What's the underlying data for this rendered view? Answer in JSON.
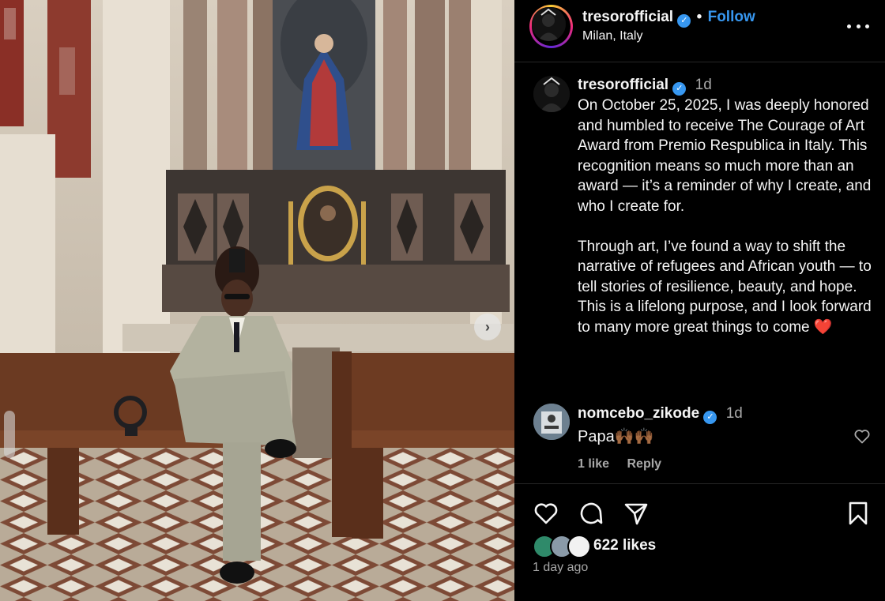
{
  "post": {
    "author": "tresorofficial",
    "location": "Milan, Italy",
    "follow_label": "Follow",
    "dot": "•",
    "verified_mark": "✓",
    "caption_time": "1d",
    "caption": "On October 25, 2025, I was deeply honored and humbled to receive The Courage of Art Award from Premio Respublica in Italy. This recognition means so much more than an award — it’s a reminder of why I create, and who I create for.\n\nThrough art, I’ve found a way to shift the narrative of refugees and African youth — to tell stories of resilience, beauty, and hope. This is a lifelong purpose, and I look forward to many more great things to come ❤️",
    "likes": "622 likes",
    "posted_ago": "1 day ago",
    "next_icon": "›"
  },
  "comment": {
    "author": "nomcebo_zikode",
    "time": "1d",
    "text": "Papa🙌🏾🙌🏾",
    "likes": "1 like",
    "reply_label": "Reply"
  },
  "icons": [
    "more-icon",
    "verified-icon",
    "heart-icon",
    "comment-icon",
    "share-icon",
    "bookmark-icon",
    "chevron-right-icon"
  ],
  "colors": {
    "accent": "#3797f0",
    "background": "#000000",
    "muted": "#a8a8a8",
    "text": "#f5f5f5"
  }
}
